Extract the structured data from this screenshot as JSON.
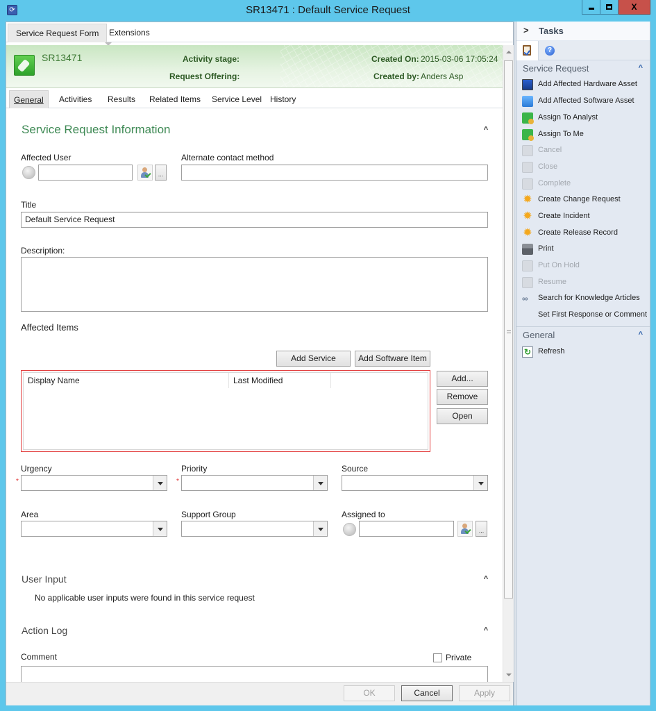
{
  "window": {
    "title": "SR13471 : Default Service Request",
    "controls": {
      "minimize": "minimize",
      "maximize": "maximize",
      "close": "X"
    }
  },
  "top_tabs": [
    {
      "label": "Service Request Form",
      "active": true
    },
    {
      "label": "Extensions",
      "active": false
    }
  ],
  "header": {
    "id": "SR13471",
    "activity_stage_label": "Activity stage:",
    "activity_stage_value": "",
    "request_offering_label": "Request Offering:",
    "request_offering_value": "",
    "created_on_label": "Created On:",
    "created_on_value": "2015-03-06 17:05:24",
    "created_by_label": "Created by:",
    "created_by_value": "Anders Asp"
  },
  "sub_tabs": [
    {
      "label": "General",
      "active": true
    },
    {
      "label": "Activities",
      "active": false
    },
    {
      "label": "Results",
      "active": false
    },
    {
      "label": "Related Items",
      "active": false
    },
    {
      "label": "Service Level",
      "active": false
    },
    {
      "label": "History",
      "active": false
    }
  ],
  "form": {
    "section_title": "Service Request Information",
    "affected_user": {
      "label": "Affected User",
      "value": ""
    },
    "alternate_contact": {
      "label": "Alternate contact method",
      "value": ""
    },
    "title": {
      "label": "Title",
      "value": "Default Service Request"
    },
    "description": {
      "label": "Description:",
      "value": ""
    },
    "affected_items": {
      "label": "Affected Items",
      "add_service_label": "Add Service",
      "add_software_label": "Add Software Item",
      "columns": [
        "Display Name",
        "Last Modified",
        ""
      ],
      "rows": [],
      "add_label": "Add...",
      "remove_label": "Remove",
      "open_label": "Open"
    },
    "urgency": {
      "label": "Urgency",
      "value": "",
      "required": true
    },
    "priority": {
      "label": "Priority",
      "value": "",
      "required": true
    },
    "source": {
      "label": "Source",
      "value": ""
    },
    "area": {
      "label": "Area",
      "value": ""
    },
    "support_group": {
      "label": "Support Group",
      "value": ""
    },
    "assigned_to": {
      "label": "Assigned to",
      "value": ""
    },
    "required_marker": "*",
    "ellipsis": "...",
    "user_input": {
      "title": "User Input",
      "message": "No applicable user inputs were found in this service request"
    },
    "action_log": {
      "title": "Action Log",
      "comment_label": "Comment",
      "comment_value": "",
      "private_label": "Private",
      "private_checked": false
    },
    "collapse_glyph": "^"
  },
  "footer": {
    "ok_label": "OK",
    "ok_enabled": false,
    "cancel_label": "Cancel",
    "apply_label": "Apply",
    "apply_enabled": false
  },
  "tasks": {
    "title": "Tasks",
    "chevron": ">",
    "tabs": [
      {
        "icon": "clipboard-icon",
        "active": true
      },
      {
        "icon": "help-icon",
        "active": false
      }
    ],
    "help_glyph": "?",
    "groups": [
      {
        "title": "Service Request",
        "items": [
          {
            "label": "Add Affected Hardware Asset",
            "icon": "hardware-asset-icon",
            "enabled": true
          },
          {
            "label": "Add Affected Software Asset",
            "icon": "software-asset-icon",
            "enabled": true
          },
          {
            "label": "Assign To Analyst",
            "icon": "assign-icon",
            "enabled": true
          },
          {
            "label": "Assign To Me",
            "icon": "assign-icon",
            "enabled": true
          },
          {
            "label": "Cancel",
            "icon": "cancel-icon",
            "enabled": false
          },
          {
            "label": "Close",
            "icon": "close-request-icon",
            "enabled": false
          },
          {
            "label": "Complete",
            "icon": "complete-icon",
            "enabled": false
          },
          {
            "label": "Create Change Request",
            "icon": "create-icon",
            "enabled": true
          },
          {
            "label": "Create Incident",
            "icon": "create-icon",
            "enabled": true
          },
          {
            "label": "Create Release Record",
            "icon": "create-icon",
            "enabled": true
          },
          {
            "label": "Print",
            "icon": "print-icon",
            "enabled": true
          },
          {
            "label": "Put On Hold",
            "icon": "hold-icon",
            "enabled": false
          },
          {
            "label": "Resume",
            "icon": "resume-icon",
            "enabled": false
          },
          {
            "label": "Search for Knowledge Articles",
            "icon": "knowledge-link-icon",
            "enabled": true
          },
          {
            "label": "Set First Response or Comment",
            "icon": "",
            "enabled": true
          }
        ]
      },
      {
        "title": "General",
        "items": [
          {
            "label": "Refresh",
            "icon": "refresh-icon",
            "enabled": true
          }
        ]
      }
    ],
    "sun_glyph": "✹",
    "link_glyph": "∞",
    "refresh_glyph": "↻"
  },
  "colors": {
    "window_frame": "#5ec7eb",
    "header_green": "#3d7a34",
    "section_title": "#3f8a55",
    "grid_border_error": "#e23b3b",
    "required_asterisk": "#e03030",
    "close_button": "#c7514a"
  }
}
